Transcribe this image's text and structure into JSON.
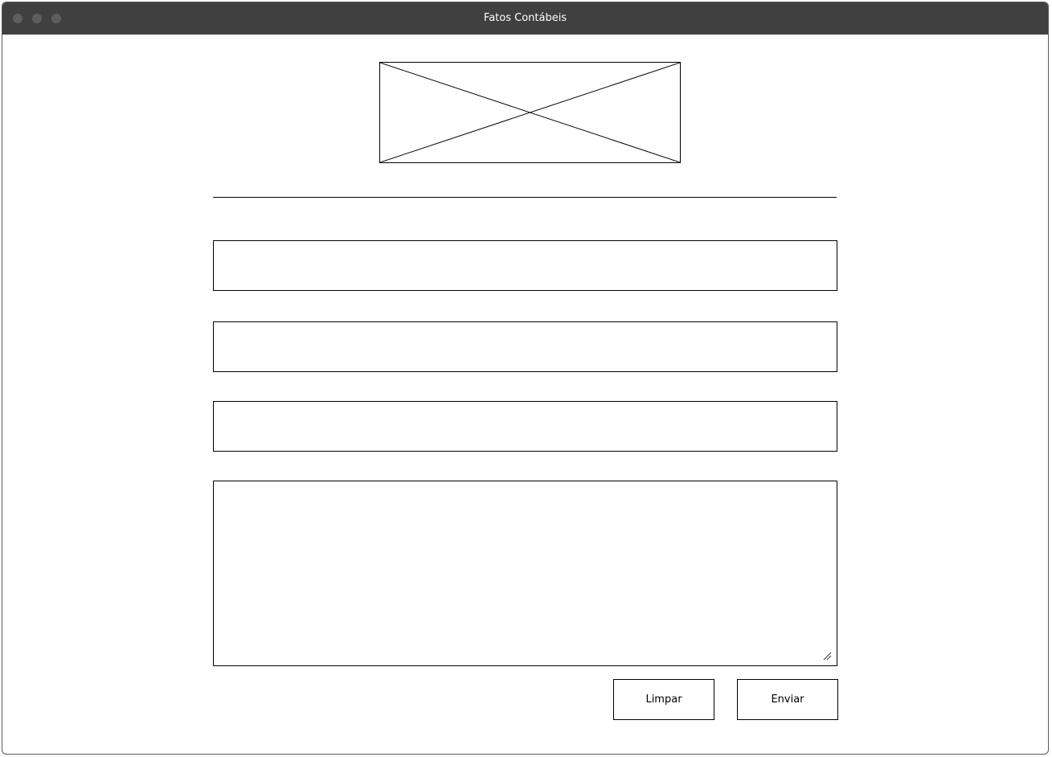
{
  "window": {
    "title": "Fatos Contábeis"
  },
  "header": {
    "logo_icon": "image-placeholder-icon"
  },
  "form": {
    "fields": [
      {
        "value": ""
      },
      {
        "value": ""
      },
      {
        "value": ""
      }
    ],
    "message": {
      "value": ""
    }
  },
  "actions": {
    "clear_label": "Limpar",
    "send_label": "Enviar"
  }
}
